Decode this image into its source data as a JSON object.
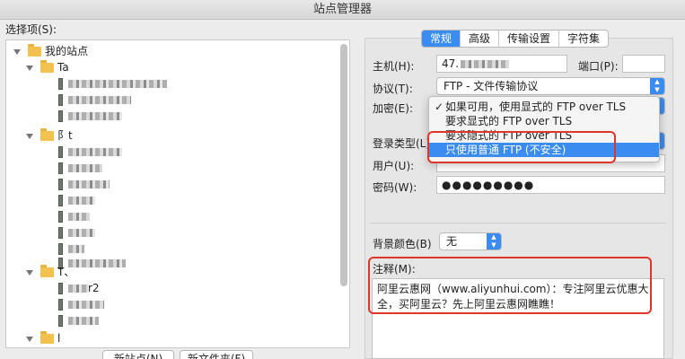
{
  "window": {
    "title": "站点管理器"
  },
  "left": {
    "select_label": "选择项(S):",
    "tree": {
      "root": "我的站点",
      "folder1": "Ta",
      "folder2": "阝t",
      "folder3": "T、",
      "folder3_item1": "r2",
      "folder4": "l"
    },
    "buttons": {
      "new_site": "新站点(N)",
      "new_folder": "新文件夹(F)"
    }
  },
  "tabs": [
    "常规",
    "高级",
    "传输设置",
    "字符集"
  ],
  "form": {
    "host_label": "主机(H):",
    "host_value": "47.",
    "port_label": "端口(P):",
    "port_value": "",
    "protocol_label": "协议(T):",
    "protocol_value": "FTP - 文件传输协议",
    "encryption_label": "加密(E):",
    "login_type_label": "登录类型(L):",
    "user_label": "用户(U):",
    "password_label": "密码(W):",
    "password_value": "●●●●●●●●●",
    "bg_color_label": "背景颜色(B)",
    "bg_color_value": "无",
    "notes_label": "注释(M):",
    "notes_text": "阿里云惠网（www.aliyunhui.com）：专注阿里云优惠大全，买阿里云？先上阿里云惠网瞧瞧！"
  },
  "encryption_menu": {
    "options": [
      "如果可用，使用显式的 FTP over TLS",
      "要求显式的 FTP over TLS",
      "要求隐式的 FTP over TLS",
      "只使用普通 FTP (不安全)"
    ],
    "checked_index": 0,
    "highlighted_index": 3
  },
  "colors": {
    "accent": "#3b8cf0",
    "highlight_box": "#e0352b",
    "folder": "#f2c14e"
  }
}
